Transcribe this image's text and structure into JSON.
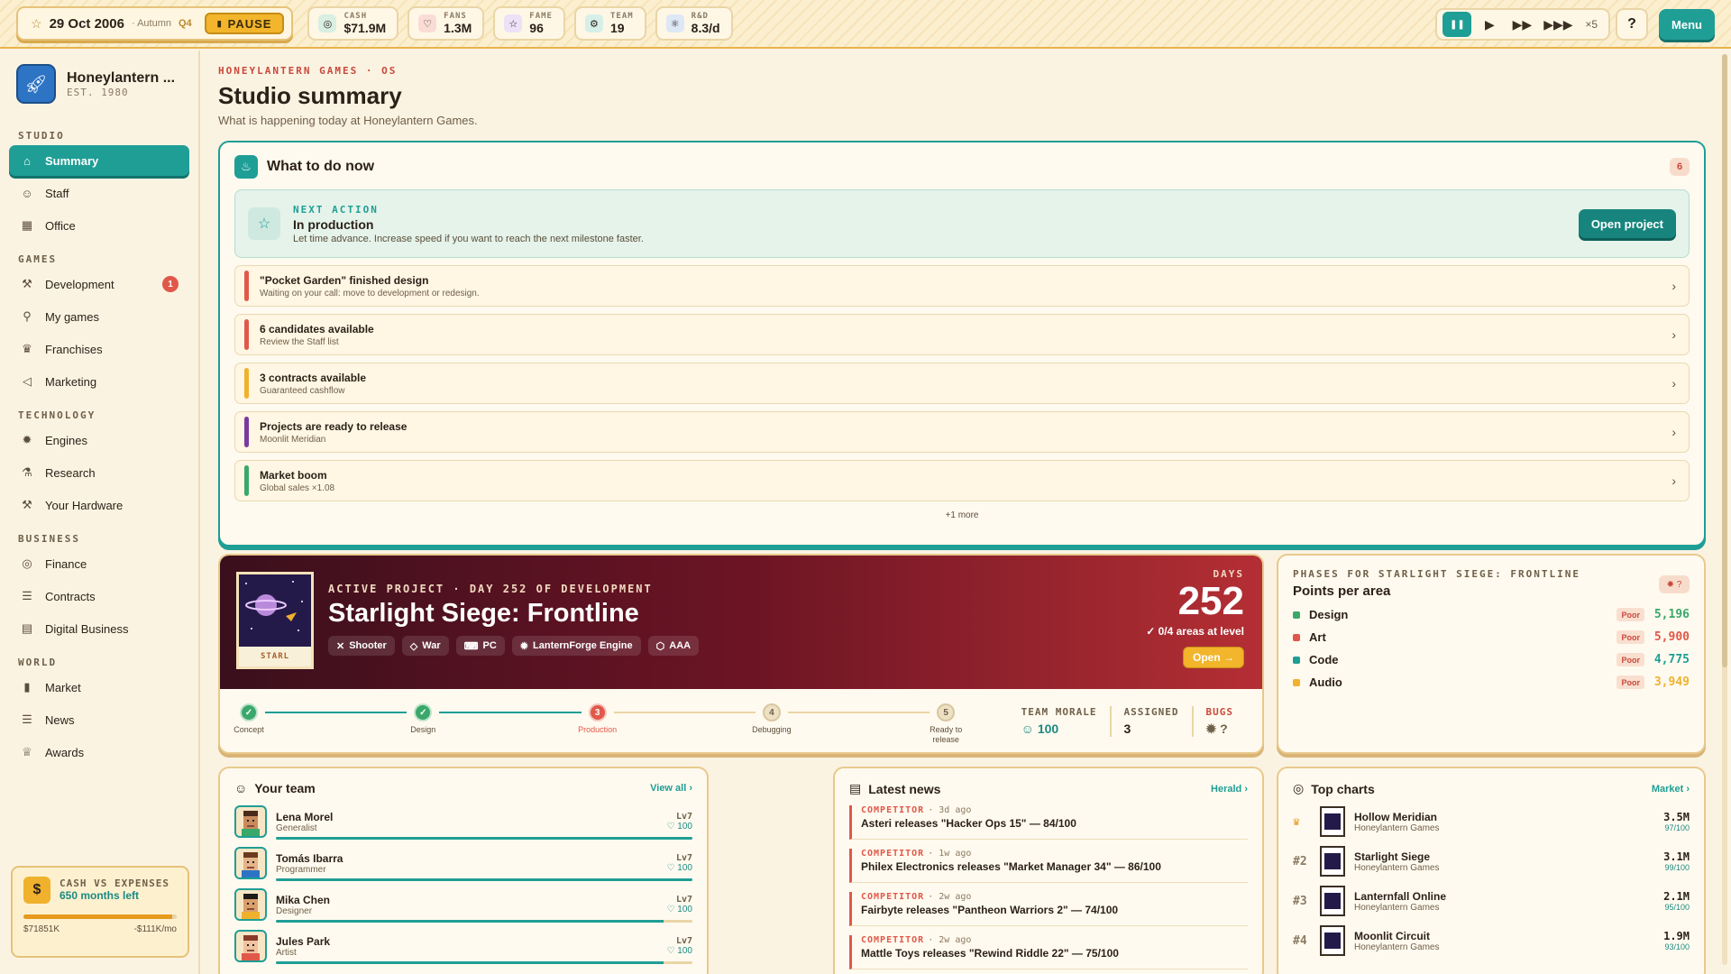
{
  "topbar": {
    "date": "29 Oct 2006",
    "season": "· Autumn",
    "quarter": "Q4",
    "pause_label": "PAUSE",
    "stats": [
      {
        "label": "CASH",
        "value": "$71.9M",
        "icon": "coin-icon",
        "color": "#d8efe2"
      },
      {
        "label": "FANS",
        "value": "1.3M",
        "icon": "heart-icon",
        "color": "#f9dcd6"
      },
      {
        "label": "FAME",
        "value": "96",
        "icon": "star-icon",
        "color": "#ece1f6"
      },
      {
        "label": "TEAM",
        "value": "19",
        "icon": "team-icon",
        "color": "#d6efe9"
      },
      {
        "label": "R&D",
        "value": "8.3/d",
        "icon": "research-icon",
        "color": "#dde7f6"
      }
    ],
    "multiplier": "×5",
    "help_label": "?",
    "menu_label": "Menu"
  },
  "sidebar": {
    "studio_name": "Honeylantern ...",
    "established": "EST. 1980",
    "sections": [
      {
        "title": "STUDIO",
        "items": [
          {
            "label": "Summary",
            "icon": "home-icon",
            "glyph": "⌂",
            "active": true
          },
          {
            "label": "Staff",
            "icon": "people-icon",
            "glyph": "☺"
          },
          {
            "label": "Office",
            "icon": "building-icon",
            "glyph": "▦"
          }
        ]
      },
      {
        "title": "GAMES",
        "items": [
          {
            "label": "Development",
            "icon": "hammer-icon",
            "glyph": "⚒",
            "badge": "1"
          },
          {
            "label": "My games",
            "icon": "joystick-icon",
            "glyph": "⚲"
          },
          {
            "label": "Franchises",
            "icon": "crown-icon",
            "glyph": "♛"
          },
          {
            "label": "Marketing",
            "icon": "megaphone-icon",
            "glyph": "◁"
          }
        ]
      },
      {
        "title": "TECHNOLOGY",
        "items": [
          {
            "label": "Engines",
            "icon": "cog-icon",
            "glyph": "✹"
          },
          {
            "label": "Research",
            "icon": "flask-icon",
            "glyph": "⚗"
          },
          {
            "label": "Your Hardware",
            "icon": "hardware-icon",
            "glyph": "⚒"
          }
        ]
      },
      {
        "title": "BUSINESS",
        "items": [
          {
            "label": "Finance",
            "icon": "coin-icon",
            "glyph": "◎"
          },
          {
            "label": "Contracts",
            "icon": "document-icon",
            "glyph": "☰"
          },
          {
            "label": "Digital Business",
            "icon": "store-icon",
            "glyph": "▤"
          }
        ]
      },
      {
        "title": "WORLD",
        "items": [
          {
            "label": "Market",
            "icon": "bar-chart-icon",
            "glyph": "▮"
          },
          {
            "label": "News",
            "icon": "newspaper-icon",
            "glyph": "☰"
          },
          {
            "label": "Awards",
            "icon": "trophy-icon",
            "glyph": "♕"
          }
        ]
      }
    ],
    "cash_card": {
      "title": "CASH VS EXPENSES",
      "months_left": "650 months left",
      "fill": 0.97,
      "cash": "$71851K",
      "expenses": "-$111K/mo"
    }
  },
  "main": {
    "breadcrumb": "HONEYLANTERN GAMES · OS",
    "title": "Studio summary",
    "subtitle": "What is happening today at Honeylantern Games.",
    "todo": {
      "title": "What to do now",
      "count": "6",
      "next_label": "NEXT ACTION",
      "next_status": "In production",
      "next_desc": "Let time advance. Increase speed if you want to reach the next milestone faster.",
      "open_label": "Open project",
      "items": [
        {
          "title": "\"Pocket Garden\" finished design",
          "sub": "Waiting on your call: move to development or redesign.",
          "color": "#e0584a"
        },
        {
          "title": "6 candidates available",
          "sub": "Review the Staff list",
          "color": "#e0584a"
        },
        {
          "title": "3 contracts available",
          "sub": "Guaranteed cashflow",
          "color": "#f0b12d"
        },
        {
          "title": "Projects are ready to release",
          "sub": "Moonlit Meridian",
          "color": "#7a3aa0"
        },
        {
          "title": "Market boom",
          "sub": "Global sales ×1.08",
          "color": "#3aa86a"
        }
      ],
      "more": "+1 more"
    },
    "project": {
      "kicker": "ACTIVE PROJECT · DAY 252 OF DEVELOPMENT",
      "name": "Starlight Siege: Frontline",
      "cover_caption": "STARL",
      "tags": [
        {
          "label": "Shooter",
          "icon": "crosshair-icon",
          "glyph": "✕"
        },
        {
          "label": "War",
          "icon": "tag-icon",
          "glyph": "◇"
        },
        {
          "label": "PC",
          "icon": "gamepad-icon",
          "glyph": "⌨"
        },
        {
          "label": "LanternForge Engine",
          "icon": "engine-icon",
          "glyph": "✹"
        },
        {
          "label": "AAA",
          "icon": "cube-icon",
          "glyph": "⬡"
        }
      ],
      "days_label": "DAYS",
      "days": "252",
      "areas": "✓ 0/4 areas at level",
      "open_label": "Open →",
      "phases": [
        {
          "num": "✓",
          "label": "Concept",
          "state": "done"
        },
        {
          "num": "✓",
          "label": "Design",
          "state": "done"
        },
        {
          "num": "3",
          "label": "Production",
          "state": "current"
        },
        {
          "num": "4",
          "label": "Debugging",
          "state": "todo"
        },
        {
          "num": "5",
          "label": "Ready to release",
          "state": "todo"
        }
      ],
      "stats": [
        {
          "label": "TEAM MORALE",
          "value": "☺ 100",
          "color": "#1c8a82"
        },
        {
          "label": "ASSIGNED",
          "value": "3",
          "color": "#2b2118"
        },
        {
          "label": "BUGS",
          "value": "✹ ?",
          "color": "#6f6049",
          "label_color": "#c9493c"
        }
      ]
    },
    "phase_card": {
      "kicker": "PHASES FOR STARLIGHT SIEGE: FRONTLINE",
      "title": "Points per area",
      "corner": "✹ ?",
      "areas": [
        {
          "name": "Design",
          "status": "Poor",
          "points": "5,196",
          "color": "#3aa86a"
        },
        {
          "name": "Art",
          "status": "Poor",
          "points": "5,900",
          "color": "#e0584a"
        },
        {
          "name": "Code",
          "status": "Poor",
          "points": "4,775",
          "color": "#1f9e95"
        },
        {
          "name": "Audio",
          "status": "Poor",
          "points": "3,949",
          "color": "#f0b12d"
        }
      ]
    },
    "team": {
      "title": "Your team",
      "link": "View all ›",
      "members": [
        {
          "name": "Lena Morel",
          "role": "Generalist",
          "level": "Lv7",
          "morale": "♡ 100",
          "fill": 1.0,
          "skin": "#c98b5d",
          "hair": "#4a2b1a",
          "shirt": "#3aa86a"
        },
        {
          "name": "Tomás Ibarra",
          "role": "Programmer",
          "level": "Lv7",
          "morale": "♡ 100",
          "fill": 1.0,
          "skin": "#e5b48a",
          "hair": "#6b3a1e",
          "shirt": "#2d74c4"
        },
        {
          "name": "Mika Chen",
          "role": "Designer",
          "level": "Lv7",
          "morale": "♡ 100",
          "fill": 0.93,
          "skin": "#d9a06b",
          "hair": "#1e1a18",
          "shirt": "#f0b12d"
        },
        {
          "name": "Jules Park",
          "role": "Artist",
          "level": "Lv7",
          "morale": "♡ 100",
          "fill": 0.93,
          "skin": "#f0c3a0",
          "hair": "#8a3b2a",
          "shirt": "#e0584a"
        }
      ]
    },
    "news": {
      "title": "Latest news",
      "link": "Herald ›",
      "items": [
        {
          "kind": "COMPETITOR",
          "time": "· 3d ago",
          "text": "Asteri releases \"Hacker Ops 15\" — 84/100"
        },
        {
          "kind": "COMPETITOR",
          "time": "· 1w ago",
          "text": "Philex Electronics releases \"Market Manager 34\" — 86/100"
        },
        {
          "kind": "COMPETITOR",
          "time": "· 2w ago",
          "text": "Fairbyte releases \"Pantheon Warriors 2\" — 74/100"
        },
        {
          "kind": "COMPETITOR",
          "time": "· 2w ago",
          "text": "Mattle Toys releases \"Rewind Riddle 22\" — 75/100"
        }
      ]
    },
    "charts": {
      "title": "Top charts",
      "link": "Market ›",
      "items": [
        {
          "rank": "♛",
          "name": "Hollow Meridian",
          "studio": "Honeylantern Games",
          "sales": "3.5M",
          "score": "97/100"
        },
        {
          "rank": "#2",
          "name": "Starlight Siege",
          "studio": "Honeylantern Games",
          "sales": "3.1M",
          "score": "99/100"
        },
        {
          "rank": "#3",
          "name": "Lanternfall Online",
          "studio": "Honeylantern Games",
          "sales": "2.1M",
          "score": "95/100"
        },
        {
          "rank": "#4",
          "name": "Moonlit Circuit",
          "studio": "Honeylantern Games",
          "sales": "1.9M",
          "score": "93/100"
        }
      ]
    }
  }
}
